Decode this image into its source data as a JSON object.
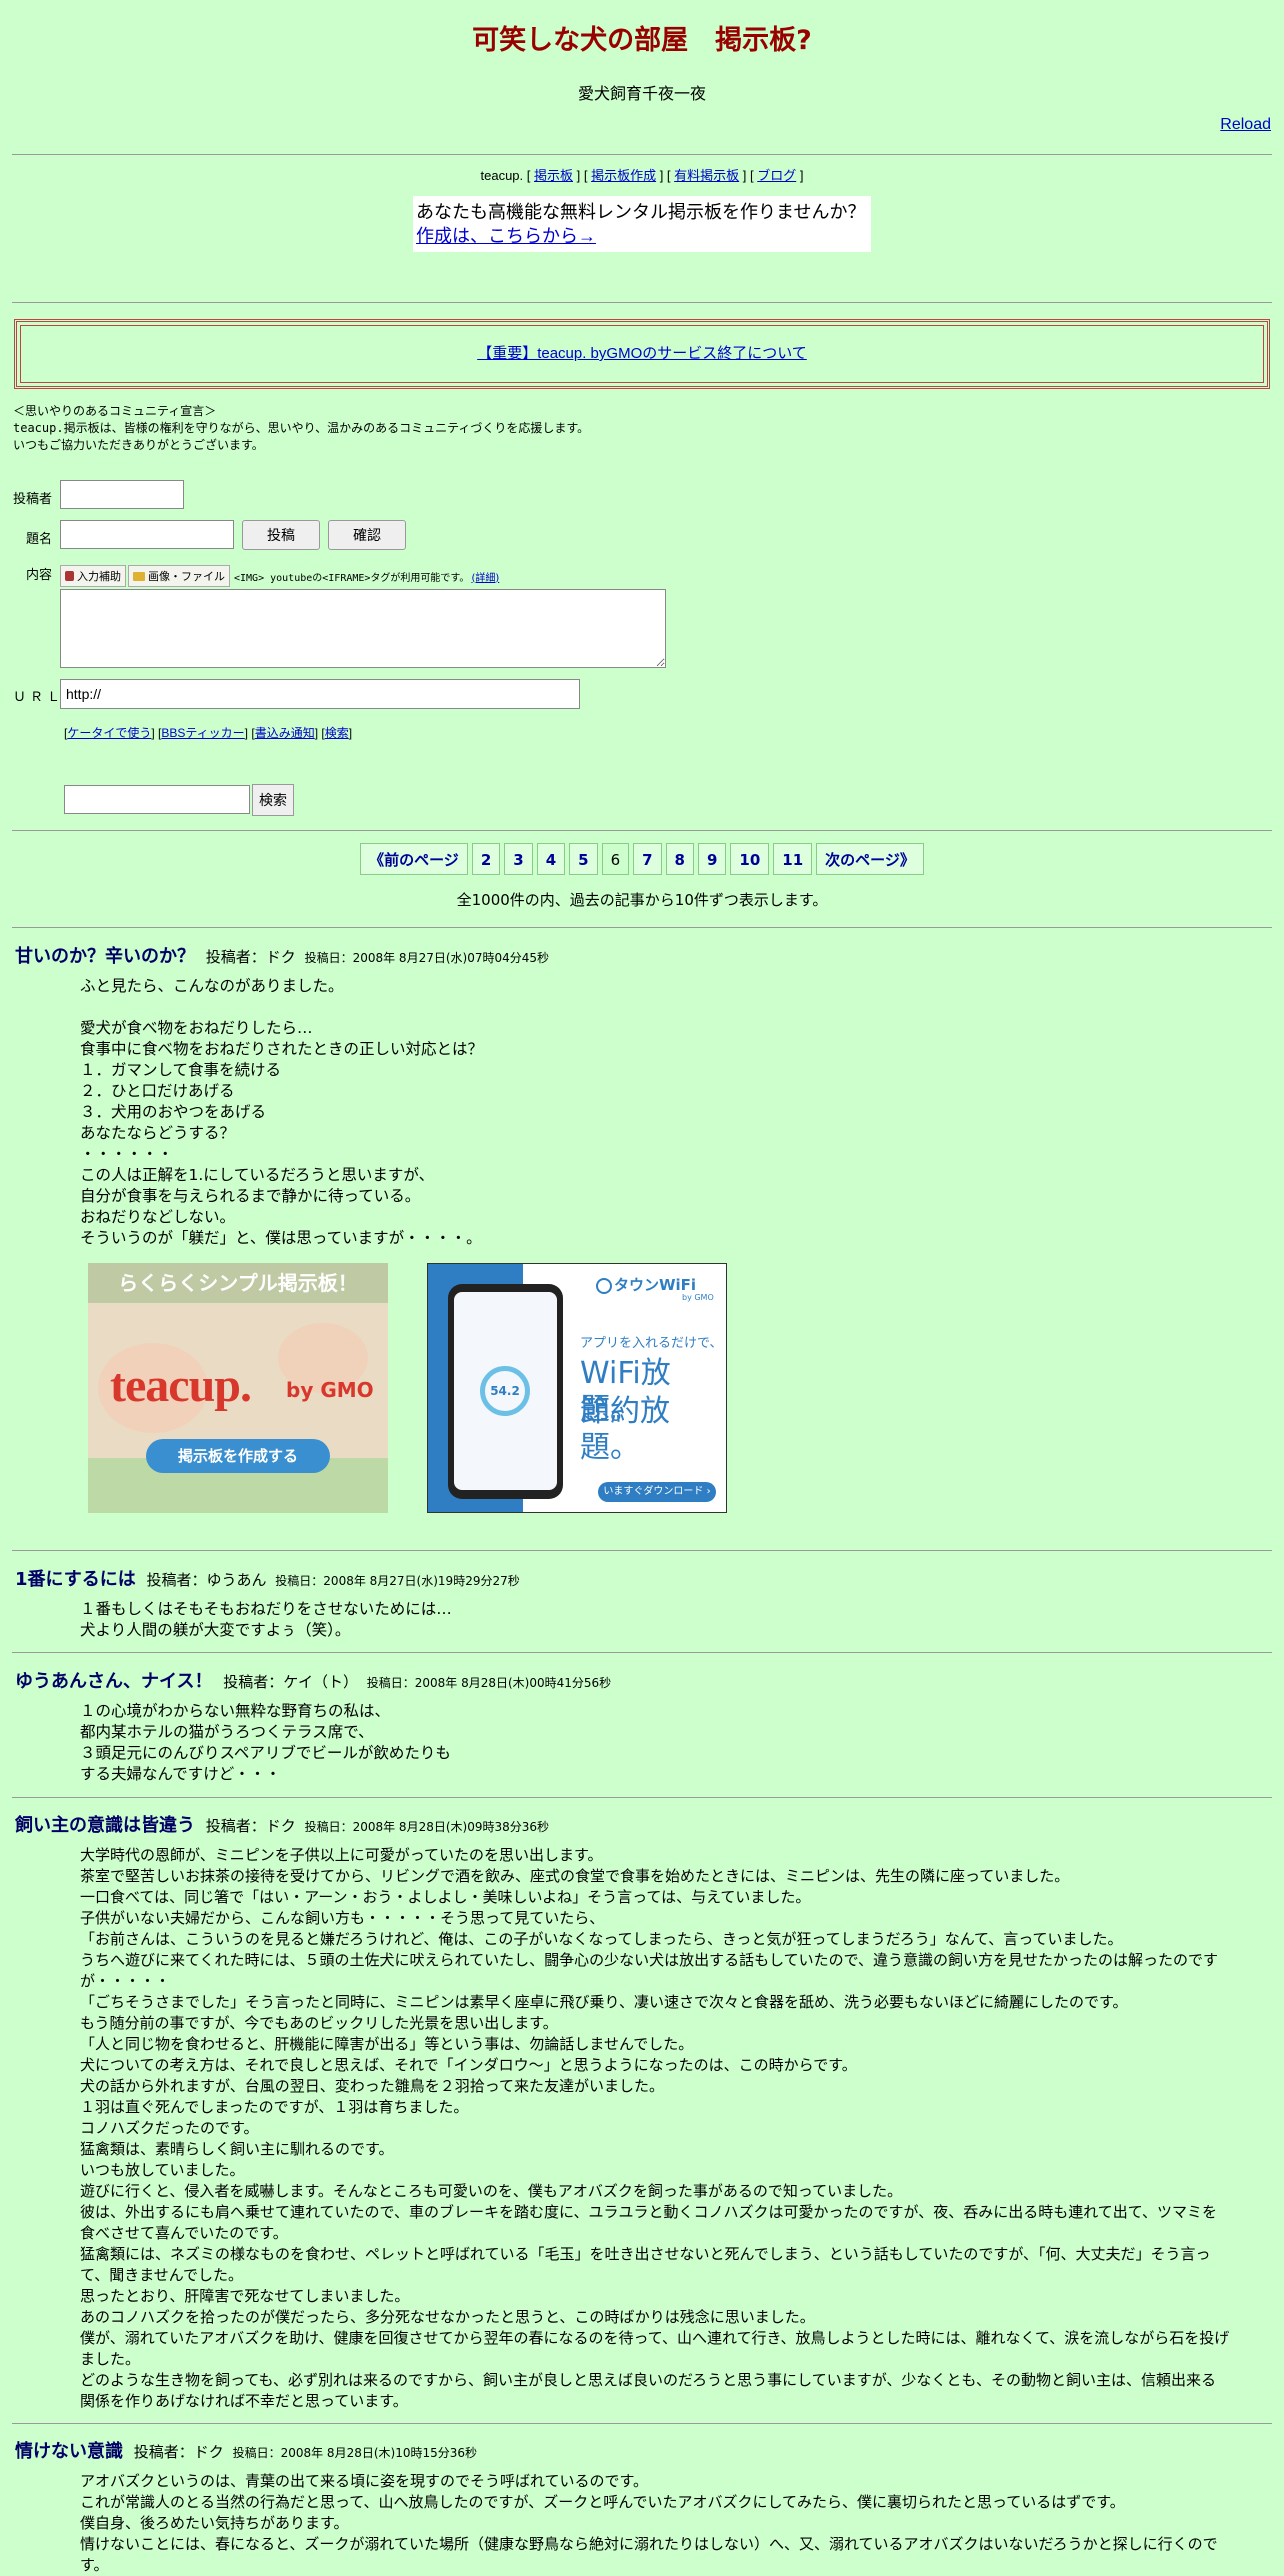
{
  "header": {
    "title": "可笑しな犬の部屋　掲示板?",
    "subtitle": "愛犬飼育千夜一夜",
    "reload_label": "Reload"
  },
  "teacup_nav": {
    "brand": "teacup.",
    "links": [
      "掲示板",
      "掲示板作成",
      "有料掲示板",
      "ブログ"
    ]
  },
  "promo": {
    "question": "あなたも高機能な無料レンタル掲示板を作りませんか？",
    "link": "作成は、こちらから→"
  },
  "notice": {
    "link": "【重要】teacup. byGMOのサービス終了について"
  },
  "declaration": {
    "line1": "＜思いやりのあるコミュニティ宣言＞",
    "line2": "teacup.掲示板は、皆様の権利を守りながら、思いやり、温かみのあるコミュニティづくりを応援します。",
    "line3": "いつもご協力いただきありがとうございます。"
  },
  "form": {
    "poster_label": "投稿者",
    "subject_label": "題名",
    "content_label": "内容",
    "url_label": "ＵＲＬ",
    "post_button": "投稿",
    "confirm_button": "確認",
    "input_assist": "入力補助",
    "image_file": "画像・ファイル",
    "tag_note": "<IMG> youtubeの<IFRAME>タグが利用可能です。",
    "tag_detail": "(詳細)",
    "url_value": "http://",
    "links": [
      "ケータイで使う",
      "BBSティッカー",
      "書込み通知",
      "検索"
    ],
    "search_button": "検索"
  },
  "pager": {
    "prev": "《前のページ",
    "pages": [
      "2",
      "3",
      "4",
      "5",
      "6",
      "7",
      "8",
      "9",
      "10",
      "11"
    ],
    "current": "6",
    "next": "次のページ》",
    "summary": "全1000件の内、過去の記事から10件ずつ表示します。"
  },
  "ads": {
    "teacup_banner": {
      "top_text": "らくらくシンプル掲示板！",
      "logo": "teacup.",
      "by": "by GMO",
      "button": "掲示板を作成する"
    },
    "wifi_banner": {
      "brand": "タウンWiFi",
      "brand_sub": "by GMO",
      "tag": "アプリを入れるだけで、",
      "line1": "WiFi放題。",
      "line2": "節約放題。",
      "button": "いますぐダウンロード ›",
      "phone_value": "54.2"
    }
  },
  "posts": [
    {
      "title": "甘いのか？辛いのか？",
      "poster": "投稿者：ドク",
      "date": "投稿日：2008年 8月27日(水)07時04分45秒",
      "body": "ふと見たら、こんなのがありました。\n\n愛犬が食べ物をおねだりしたら…\n食事中に食べ物をおねだりされたときの正しい対応とは？\n１．ガマンして食事を続ける\n２．ひと口だけあげる\n３．犬用のおやつをあげる\nあなたならどうする？\n・・・・・・\nこの人は正解を1.にしているだろうと思いますが、\n自分が食事を与えられるまで静かに待っている。\nおねだりなどしない。\nそういうのが「躾だ」と、僕は思っていますが・・・・。"
    },
    {
      "title": "1番にするには",
      "poster": "投稿者：ゆうあん",
      "date": "投稿日：2008年 8月27日(水)19時29分27秒",
      "body": "１番もしくはそもそもおねだりをさせないためには…\n犬より人間の躾が大変ですよぅ（笑）。"
    },
    {
      "title": "ゆうあんさん、ナイス！",
      "poster": "投稿者：ケイ（ト）",
      "date": "投稿日：2008年 8月28日(木)00時41分56秒",
      "body": "１の心境がわからない無粋な野育ちの私は、\n都内某ホテルの猫がうろつくテラス席で、\n３頭足元にのんびりスペアリブでビールが飲めたりも\nする夫婦なんですけど・・・"
    },
    {
      "title": "飼い主の意識は皆違う",
      "poster": "投稿者：ドク",
      "date": "投稿日：2008年 8月28日(木)09時38分36秒",
      "body": "大学時代の恩師が、ミニピンを子供以上に可愛がっていたのを思い出します。\n茶室で堅苦しいお抹茶の接待を受けてから、リビングで酒を飲み、座式の食堂で食事を始めたときには、ミニピンは、先生の隣に座っていました。\n一口食べては、同じ箸で「はい・アーン・おう・よしよし・美味しいよね」そう言っては、与えていました。\n子供がいない夫婦だから、こんな飼い方も・・・・・そう思って見ていたら、\n「お前さんは、こういうのを見ると嫌だろうけれど、俺は、この子がいなくなってしまったら、きっと気が狂ってしまうだろう」なんて、言っていました。\nうちへ遊びに来てくれた時には、５頭の土佐犬に吠えられていたし、闘争心の少ない犬は放出する話もしていたので、違う意識の飼い方を見せたかったのは解ったのですが・・・・・\n「ごちそうさまでした」そう言ったと同時に、ミニピンは素早く座卓に飛び乗り、凄い速さで次々と食器を舐め、洗う必要もないほどに綺麗にしたのです。\nもう随分前の事ですが、今でもあのビックリした光景を思い出します。\n「人と同じ物を食わせると、肝機能に障害が出る」等という事は、勿論話しませんでした。\n犬についての考え方は、それで良しと思えば、それで「インダロウ～」と思うようになったのは、この時からです。\n犬の話から外れますが、台風の翌日、変わった雛鳥を２羽拾って来た友達がいました。\n１羽は直ぐ死んでしまったのですが、１羽は育ちました。\nコノハズクだったのです。\n猛禽類は、素晴らしく飼い主に馴れるのです。\nいつも放していました。\n遊びに行くと、侵入者を威嚇します。そんなところも可愛いのを、僕もアオバズクを飼った事があるので知っていました。\n彼は、外出するにも肩へ乗せて連れていたので、車のブレーキを踏む度に、ユラユラと動くコノハズクは可愛かったのですが、夜、呑みに出る時も連れて出て、ツマミを食べさせて喜んでいたのです。\n猛禽類には、ネズミの様なものを食わせ、ペレットと呼ばれている「毛玉」を吐き出させないと死んでしまう、という話もしていたのですが、「何、大丈夫だ」そう言って、聞きませんでした。\n思ったとおり、肝障害で死なせてしまいました。\nあのコノハズクを拾ったのが僕だったら、多分死なせなかったと思うと、この時ばかりは残念に思いました。\n僕が、溺れていたアオバズクを助け、健康を回復させてから翌年の春になるのを待って、山へ連れて行き、放鳥しようとした時には、離れなくて、涙を流しながら石を投げました。\nどのような生き物を飼っても、必ず別れは来るのですから、飼い主が良しと思えば良いのだろうと思う事にしていますが、少なくとも、その動物と飼い主は、信頼出来る関係を作りあげなければ不幸だと思っています。"
    },
    {
      "title": "情けない意識",
      "poster": "投稿者：ドク",
      "date": "投稿日：2008年 8月28日(木)10時15分36秒",
      "body": "アオバズクというのは、青葉の出て来る頃に姿を現すのでそう呼ばれているのです。\nこれが常識人のとる当然の行為だと思って、山へ放鳥したのですが、ズークと呼んでいたアオバズクにしてみたら、僕に裏切られたと思っているはずです。\n僕自身、後ろめたい気持ちがあります。\n情けないことには、春になると、ズークが溺れていた場所（健康な野鳥なら絶対に溺れたりはしない）へ、又、溺れているアオバズクはいないだろうかと探しに行くのです。"
    }
  ]
}
